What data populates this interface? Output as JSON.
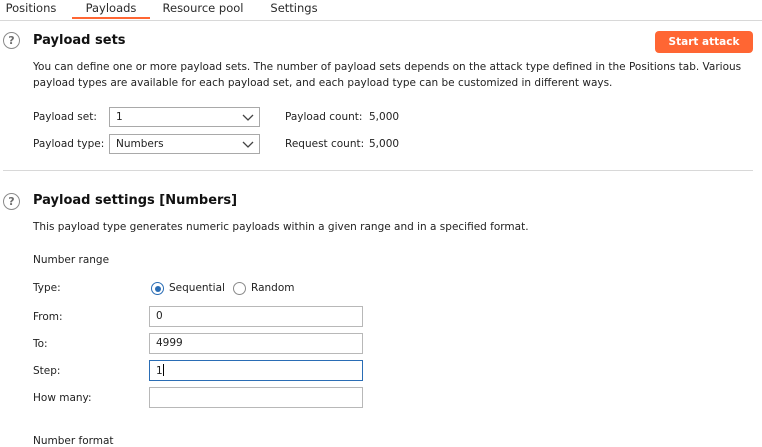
{
  "tabs": [
    {
      "label": "Positions",
      "active": false
    },
    {
      "label": "Payloads",
      "active": true
    },
    {
      "label": "Resource pool",
      "active": false
    },
    {
      "label": "Settings",
      "active": false
    }
  ],
  "payload_sets": {
    "title": "Payload sets",
    "start_attack_label": "Start attack",
    "description_line1": "You can define one or more payload sets. The number of payload sets depends on the attack type defined in the Positions tab. Various",
    "description_line2": "payload types are available for each payload set, and each payload type can be customized in different ways.",
    "payload_set_label": "Payload set:",
    "payload_set_value": "1",
    "payload_type_label": "Payload type:",
    "payload_type_value": "Numbers",
    "payload_count_label": "Payload count:",
    "payload_count_value": "5,000",
    "request_count_label": "Request count:",
    "request_count_value": "5,000"
  },
  "payload_settings": {
    "title": "Payload settings [Numbers]",
    "description": "This payload type generates numeric payloads within a given range and in a specified format.",
    "number_range_heading": "Number range",
    "type_label": "Type:",
    "type_options": [
      "Sequential",
      "Random"
    ],
    "type_selected": "Sequential",
    "from_label": "From:",
    "from_value": "0",
    "to_label": "To:",
    "to_value": "4999",
    "step_label": "Step:",
    "step_value": "1",
    "how_many_label": "How many:",
    "how_many_value": "",
    "number_format_heading": "Number format"
  },
  "colors": {
    "accent": "#ff6633",
    "radio_selected": "#2a6db5",
    "focus_border": "#2a6db5"
  },
  "icons": {
    "help": "question-circle",
    "dropdown": "chevron-down"
  }
}
